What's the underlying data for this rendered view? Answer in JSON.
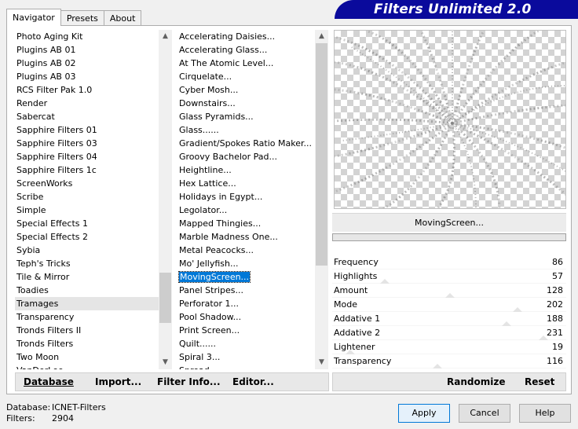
{
  "tabs": [
    "Navigator",
    "Presets",
    "About"
  ],
  "banner_title": "Filters Unlimited 2.0",
  "categories": [
    "Photo Aging Kit",
    "Plugins AB 01",
    "Plugins AB 02",
    "Plugins AB 03",
    "RCS Filter Pak 1.0",
    "Render",
    "Sabercat",
    "Sapphire Filters 01",
    "Sapphire Filters 03",
    "Sapphire Filters 04",
    "Sapphire Filters 1c",
    "ScreenWorks",
    "Scribe",
    "Simple",
    "Special Effects 1",
    "Special Effects 2",
    "Sybia",
    "Teph's Tricks",
    "Tile & Mirror",
    "Toadies",
    "Tramages",
    "Transparency",
    "Tronds Filters II",
    "Tronds Filters",
    "Two Moon",
    "VanDerLee"
  ],
  "selected_category": "Tramages",
  "filters": [
    "Accelerating Daisies...",
    "Accelerating Glass...",
    "At The Atomic Level...",
    "Cirquelate...",
    "Cyber Mosh...",
    "Downstairs...",
    "Glass Pyramids...",
    "Glass......",
    "Gradient/Spokes Ratio Maker...",
    "Groovy Bachelor Pad...",
    "Heightline...",
    "Hex Lattice...",
    "Holidays in Egypt...",
    "Legolator...",
    "Mapped Thingies...",
    "Marble Madness One...",
    "Metal Peacocks...",
    "Mo' Jellyfish...",
    "MovingScreen...",
    "Panel Stripes...",
    "Perforator 1...",
    "Pool Shadow...",
    "Print Screen...",
    "Quilt......",
    "Spiral 3...",
    "Spread..."
  ],
  "selected_filter": "MovingScreen...",
  "left_buttons": {
    "database": "Database",
    "import": "Import...",
    "filter_info": "Filter Info...",
    "editor": "Editor..."
  },
  "filter_name": "MovingScreen...",
  "parameters": [
    {
      "label": "Frequency",
      "value": "86"
    },
    {
      "label": "Highlights",
      "value": "57"
    },
    {
      "label": "Amount",
      "value": "128"
    },
    {
      "label": "Mode",
      "value": "202"
    },
    {
      "label": "Addative 1",
      "value": "188"
    },
    {
      "label": "Addative 2",
      "value": "231"
    },
    {
      "label": "Lightener",
      "value": "19"
    },
    {
      "label": "Transparency",
      "value": "116"
    }
  ],
  "randomize_label": "Randomize",
  "reset_label": "Reset",
  "status": {
    "database_label": "Database:",
    "database_value": "ICNET-Filters",
    "filters_label": "Filters:",
    "filters_value": "2904"
  },
  "dialog_buttons": {
    "apply": "Apply",
    "cancel": "Cancel",
    "help": "Help"
  },
  "icons": {
    "scroll_up": "chevron-up-icon",
    "scroll_down": "chevron-down-icon"
  }
}
